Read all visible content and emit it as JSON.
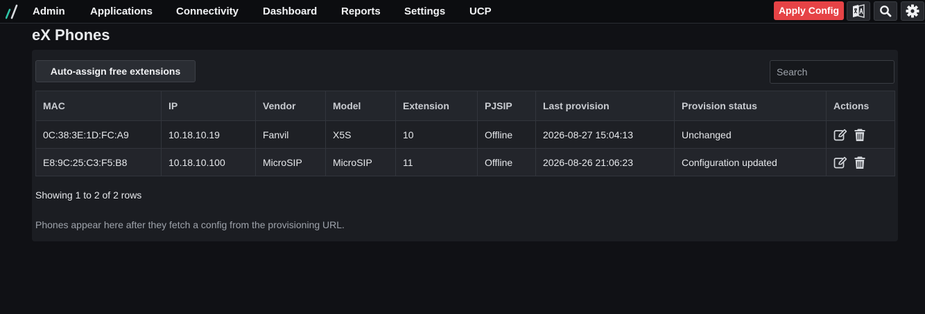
{
  "nav": {
    "items": [
      {
        "label": "Admin"
      },
      {
        "label": "Applications"
      },
      {
        "label": "Connectivity"
      },
      {
        "label": "Dashboard"
      },
      {
        "label": "Reports"
      },
      {
        "label": "Settings"
      },
      {
        "label": "UCP"
      }
    ],
    "apply_label": "Apply Config",
    "icons": [
      "language-icon",
      "search-icon",
      "gear-icon"
    ],
    "accent_color": "#e64346"
  },
  "page": {
    "title": "eX Phones"
  },
  "toolbar": {
    "auto_assign_label": "Auto-assign free extensions",
    "search_placeholder": "Search"
  },
  "table": {
    "columns": [
      "MAC",
      "IP",
      "Vendor",
      "Model",
      "Extension",
      "PJSIP",
      "Last provision",
      "Provision status",
      "Actions"
    ],
    "rows": [
      {
        "mac": "0C:38:3E:1D:FC:A9",
        "ip": "10.18.10.19",
        "vendor": "Fanvil",
        "model": "X5S",
        "extension": "10",
        "pjsip": "Offline",
        "last_provision": "2026-08-27 15:04:13",
        "status": "Unchanged"
      },
      {
        "mac": "E8:9C:25:C3:F5:B8",
        "ip": "10.18.10.100",
        "vendor": "MicroSIP",
        "model": "MicroSIP",
        "extension": "11",
        "pjsip": "Offline",
        "last_provision": "2026-08-26 21:06:23",
        "status": "Configuration updated"
      }
    ],
    "row_action_icons": [
      "edit-icon",
      "trash-icon"
    ]
  },
  "footer": {
    "rows_info": "Showing 1 to 2 of 2 rows",
    "hint": "Phones appear here after they fetch a config from the provisioning URL."
  }
}
